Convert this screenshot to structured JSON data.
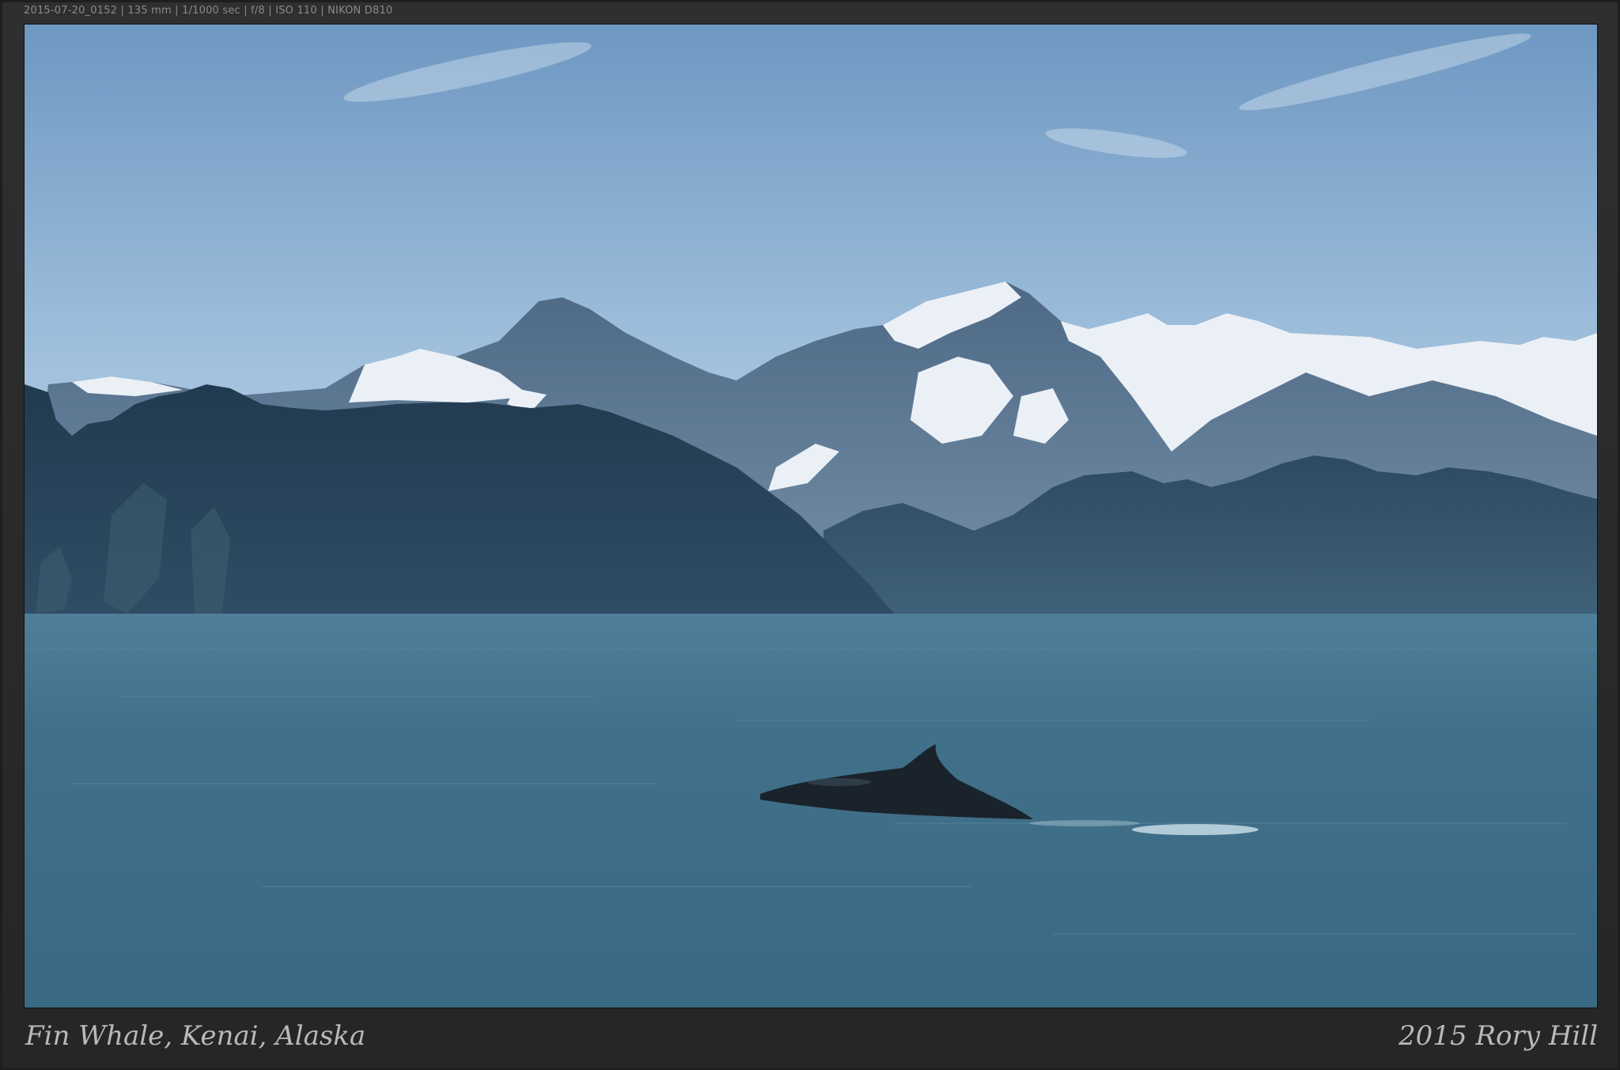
{
  "exif_line": "2015-07-20_0152 | 135 mm | 1/1000 sec | f/8 | ISO 110 | NIKON D810",
  "caption": "Fin Whale, Kenai, Alaska",
  "credit": "2015 Rory Hill",
  "colors": {
    "frame": "#2c2c2c",
    "sky_top": "#6e98c2",
    "sky_bottom": "#c2d6e6",
    "mountain_far": "#5a7590",
    "snow": "#eef3f8",
    "hill_dark": "#27435a",
    "water": "#3f6e88",
    "whale": "#1a232b"
  }
}
